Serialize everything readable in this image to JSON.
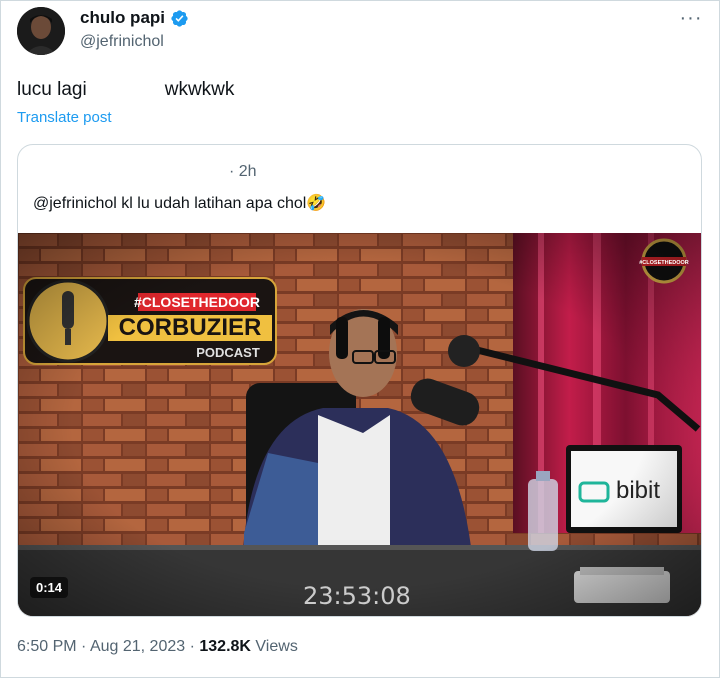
{
  "author": {
    "display_name": "chulo papi",
    "handle": "@jefrinichol"
  },
  "tweet": {
    "text_before": "lucu lagi",
    "text_after": "wkwkwk",
    "translate_label": "Translate post"
  },
  "quote": {
    "time": "· 2h",
    "text": "@jefrinichol kl lu udah latihan apa chol🤣",
    "video": {
      "duration": "0:14",
      "overlay_clock": "23:53:08",
      "sign_hashtag": "#CLOSETHEDOOR",
      "sign_name": "CORBUZIER",
      "sign_sub": "PODCAST",
      "screen_brand": "bibit",
      "corner_logo": "#CLOSETHEDOOR"
    }
  },
  "footer": {
    "time": "6:50 PM",
    "date": "Aug 21, 2023",
    "views_count": "132.8K",
    "views_label": "Views"
  },
  "colors": {
    "accent": "#1d9bf0",
    "muted": "#536471",
    "verified": "#1d9bf0"
  }
}
